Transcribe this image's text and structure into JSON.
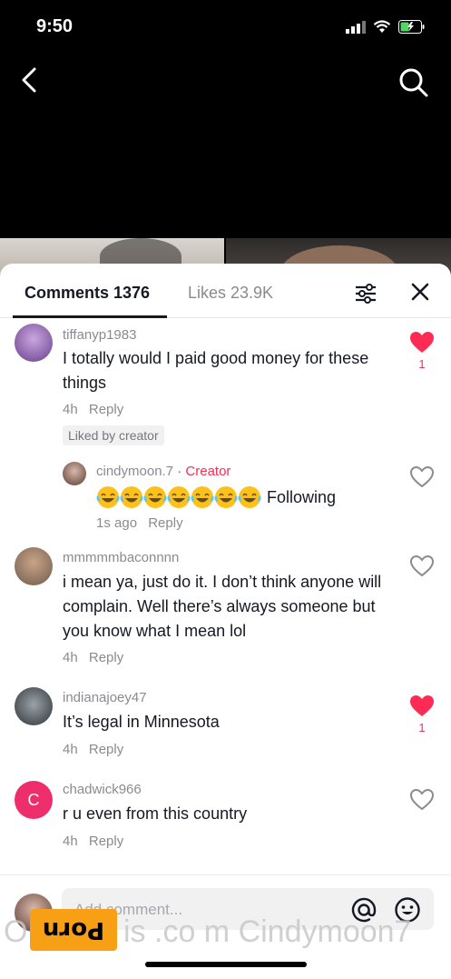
{
  "status": {
    "time": "9:50"
  },
  "tabs": {
    "comments_label": "Comments 1376",
    "likes_label": "Likes 23.9K"
  },
  "comments": [
    {
      "username": "tiffanyp1983",
      "text": "I totally would I paid good money for these things",
      "time": "4h",
      "reply": "Reply",
      "badge": "Liked by creator",
      "liked": true,
      "like_count": "1"
    },
    {
      "username": "cindymoon.7",
      "creator_tag": "· Creator",
      "text_suffix": "Following",
      "emoji": "face-with-tears-of-joy",
      "emoji_count": 7,
      "time": "1s ago",
      "reply": "Reply",
      "liked": false
    },
    {
      "username": "mmmmmbaconnnn",
      "text": "i mean ya, just do it. I don’t think anyone will complain. Well there’s always someone but you know what I mean lol",
      "time": "4h",
      "reply": "Reply",
      "liked": false
    },
    {
      "username": "indianajoey47",
      "text": "It’s legal in Minnesota",
      "time": "4h",
      "reply": "Reply",
      "liked": true,
      "like_count": "1"
    },
    {
      "username": "chadwick966",
      "avatar_letter": "C",
      "text": "r u even from this country",
      "time": "4h",
      "reply": "Reply",
      "liked": false
    }
  ],
  "input": {
    "placeholder": "Add comment..."
  },
  "watermark": {
    "badge": "Porn",
    "text": "O",
    "text2": "is .co m Cindymoon7"
  },
  "colors": {
    "accent": "#fe2c55",
    "muted": "#8a8b91",
    "text": "#161823"
  }
}
